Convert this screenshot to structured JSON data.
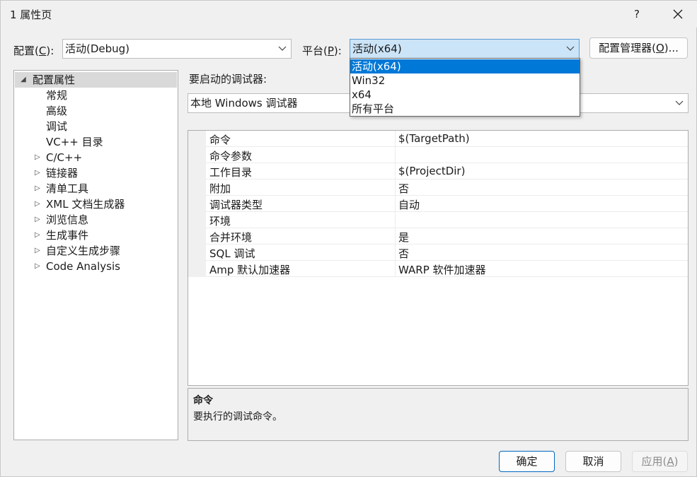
{
  "window": {
    "title": "1 属性页",
    "help": "?"
  },
  "config": {
    "label": "配置(C):",
    "value": "活动(Debug)"
  },
  "platform": {
    "label": "平台(P):",
    "value": "活动(x64)",
    "options": [
      "活动(x64)",
      "Win32",
      "x64",
      "所有平台"
    ],
    "selected_index": 0
  },
  "config_manager": "配置管理器(O)...",
  "tree": {
    "root": "配置属性",
    "items": [
      {
        "label": "常规",
        "expandable": false
      },
      {
        "label": "高级",
        "expandable": false
      },
      {
        "label": "调试",
        "expandable": false
      },
      {
        "label": "VC++ 目录",
        "expandable": false
      },
      {
        "label": "C/C++",
        "expandable": true
      },
      {
        "label": "链接器",
        "expandable": true
      },
      {
        "label": "清单工具",
        "expandable": true
      },
      {
        "label": "XML 文档生成器",
        "expandable": true
      },
      {
        "label": "浏览信息",
        "expandable": true
      },
      {
        "label": "生成事件",
        "expandable": true
      },
      {
        "label": "自定义生成步骤",
        "expandable": true
      },
      {
        "label": "Code Analysis",
        "expandable": true
      }
    ]
  },
  "debugger": {
    "label": "要启动的调试器:",
    "value": "本地 Windows 调试器"
  },
  "properties": [
    {
      "name": "命令",
      "value": "$(TargetPath)"
    },
    {
      "name": "命令参数",
      "value": ""
    },
    {
      "name": "工作目录",
      "value": "$(ProjectDir)"
    },
    {
      "name": "附加",
      "value": "否"
    },
    {
      "name": "调试器类型",
      "value": "自动"
    },
    {
      "name": "环境",
      "value": ""
    },
    {
      "name": "合并环境",
      "value": "是"
    },
    {
      "name": "SQL 调试",
      "value": "否"
    },
    {
      "name": "Amp 默认加速器",
      "value": "WARP 软件加速器"
    }
  ],
  "description": {
    "title": "命令",
    "text": "要执行的调试命令。"
  },
  "buttons": {
    "ok": "确定",
    "cancel": "取消",
    "apply": "应用(A)"
  }
}
